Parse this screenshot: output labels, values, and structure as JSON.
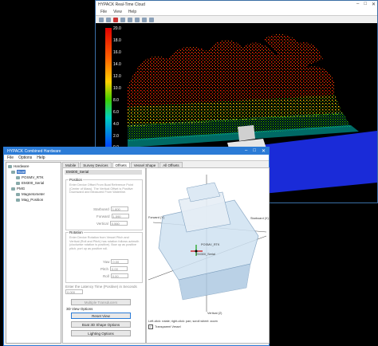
{
  "pointcloud_window": {
    "title": "HYPACK Real-Time Cloud",
    "menu": [
      "File",
      "View",
      "Help"
    ],
    "legend_values": [
      "20.0",
      "18.0",
      "16.0",
      "14.0",
      "12.0",
      "10.0",
      "8.0",
      "6.0",
      "4.0",
      "2.0",
      "0.0"
    ],
    "colors": {
      "high": "#e00000",
      "mid": "#ffd000",
      "low_mid": "#40d000",
      "low": "#0040ff",
      "water": "#1a2bd8"
    }
  },
  "hardware_window": {
    "title": "HYPACK Combined Hardware",
    "menu": [
      "File",
      "Options",
      "Help"
    ],
    "tree": [
      {
        "label": "Hardware",
        "level": 0
      },
      {
        "label": "Boat",
        "level": 1,
        "selected": true
      },
      {
        "label": "POSMV_RTK",
        "level": 2
      },
      {
        "label": "EM300_Serial",
        "level": 2
      },
      {
        "label": "PMG",
        "level": 1
      },
      {
        "label": "Magnetometer",
        "level": 2
      },
      {
        "label": "Mag_Position",
        "level": 2
      }
    ],
    "tabs": [
      "Mobile",
      "Survey Devices",
      "Offsets",
      "Vessel Shape",
      "All Offsets"
    ],
    "active_tab": "Offsets",
    "panel_header": "EM300_Serial",
    "position": {
      "title": "Position",
      "description": "Enter Device Offset From Boat Reference Point (Center of Mass). The Vertical Offset is Positive Downward and Measured From Waterline.",
      "fields": [
        {
          "label": "Starboard",
          "value": "1.800"
        },
        {
          "label": "Forward",
          "value": "1.590"
        },
        {
          "label": "Vertical",
          "value": "0.560"
        }
      ]
    },
    "rotation": {
      "title": "Rotation",
      "description": "Enter Device Rotation from Vessel Pitch and Vertical (Roll and Pitch) has rotation follows azimuth (clockwise rotation is positive). Bow up as positive pitch, port up as positive roll.",
      "fields": [
        {
          "label": "Yaw",
          "value": "0.00"
        },
        {
          "label": "Pitch",
          "value": "0.00"
        },
        {
          "label": "Roll",
          "value": "0.00"
        }
      ]
    },
    "latency": {
      "label": "Enter the Latency Time (Positive) in Seconds",
      "value": "0.000"
    },
    "buttons": {
      "multiple_transducers": "Multiple Transducers",
      "view_options": "3D View Options",
      "reset_view": "Reset View",
      "boat_shape": "Boat 3D Shape Options",
      "lighting": "Lighting Options"
    },
    "view_labels": {
      "forward": "Forward (Y)",
      "starboard": "Starboard (X)",
      "vertical": "Vertical (Z)",
      "posmv": "POSMV_RTK",
      "em300": "EM300_Serial",
      "hint": "Left-click: rotate; right-click: pan; scroll wheel: zoom",
      "transparent": "Transparent Vessel"
    }
  }
}
